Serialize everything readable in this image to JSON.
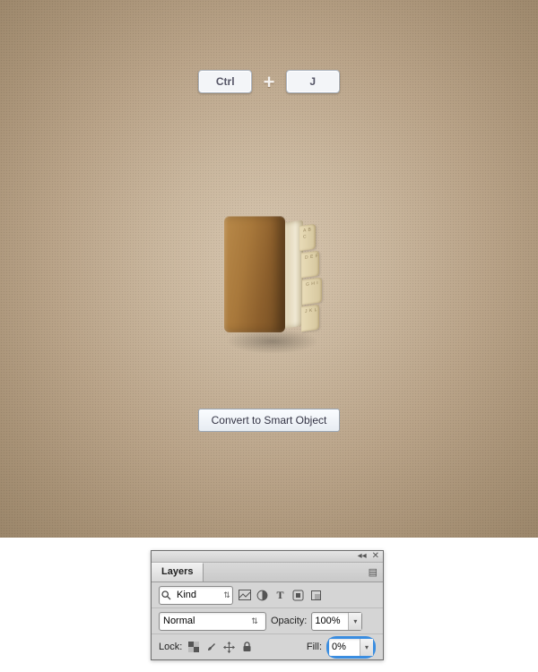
{
  "shortcut": {
    "key1": "Ctrl",
    "plus": "+",
    "key2": "J"
  },
  "action_button": {
    "label": "Convert to Smart Object"
  },
  "book": {
    "tabs": [
      "A\nB\nC",
      "D\nE\nF",
      "G\nH\nI",
      "J\nK\nL"
    ]
  },
  "layers_panel": {
    "title": "Layers",
    "filter": {
      "value": "Kind"
    },
    "filter_icons": [
      "image",
      "adjust",
      "text",
      "shape",
      "smartobj"
    ],
    "blend_mode": {
      "value": "Normal"
    },
    "opacity": {
      "label": "Opacity:",
      "value": "100%"
    },
    "lock": {
      "label": "Lock:"
    },
    "lock_icons": [
      "pixels",
      "brush",
      "move",
      "all"
    ],
    "fill": {
      "label": "Fill:",
      "value": "0%"
    }
  }
}
